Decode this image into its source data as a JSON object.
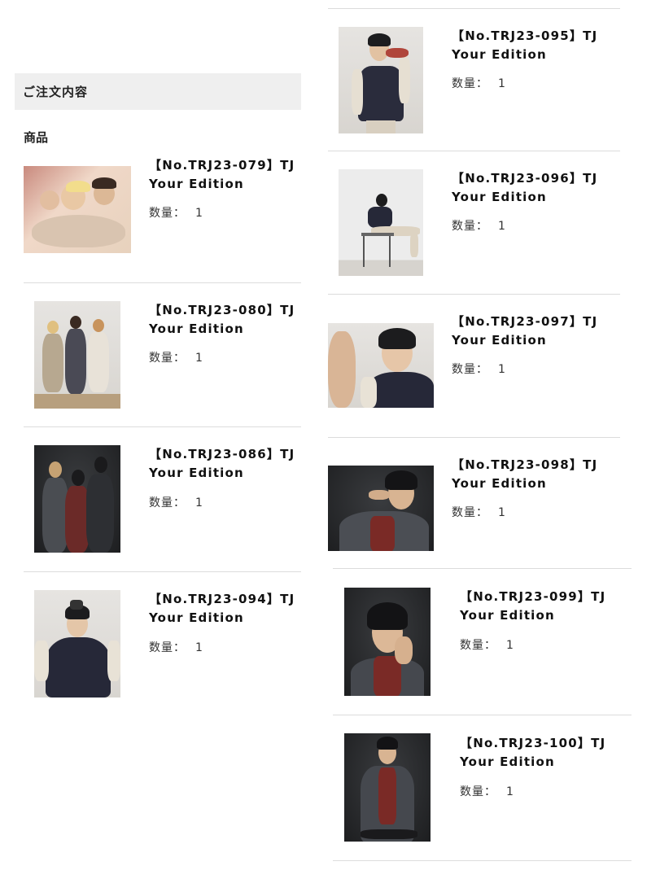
{
  "section": {
    "title": "ご注文内容",
    "products_label": "商品"
  },
  "quantity_label": "数量：",
  "items": [
    {
      "title_line1": "【No.TRJ23-079】TJ",
      "title_line2": "Your Edition",
      "quantity": "1"
    },
    {
      "title_line1": "【No.TRJ23-080】TJ",
      "title_line2": "Your Edition",
      "quantity": "1"
    },
    {
      "title_line1": "【No.TRJ23-086】TJ",
      "title_line2": "Your Edition",
      "quantity": "1"
    },
    {
      "title_line1": "【No.TRJ23-094】TJ",
      "title_line2": "Your Edition",
      "quantity": "1"
    },
    {
      "title_line1": "【No.TRJ23-095】TJ",
      "title_line2": "Your Edition",
      "quantity": "1"
    },
    {
      "title_line1": "【No.TRJ23-096】TJ",
      "title_line2": "Your Edition",
      "quantity": "1"
    },
    {
      "title_line1": "【No.TRJ23-097】TJ",
      "title_line2": "Your Edition",
      "quantity": "1"
    },
    {
      "title_line1": "【No.TRJ23-098】TJ",
      "title_line2": "Your Edition",
      "quantity": "1"
    },
    {
      "title_line1": "【No.TRJ23-099】TJ",
      "title_line2": "Your Edition",
      "quantity": "1"
    },
    {
      "title_line1": "【No.TRJ23-100】TJ",
      "title_line2": "Your Edition",
      "quantity": "1"
    }
  ]
}
